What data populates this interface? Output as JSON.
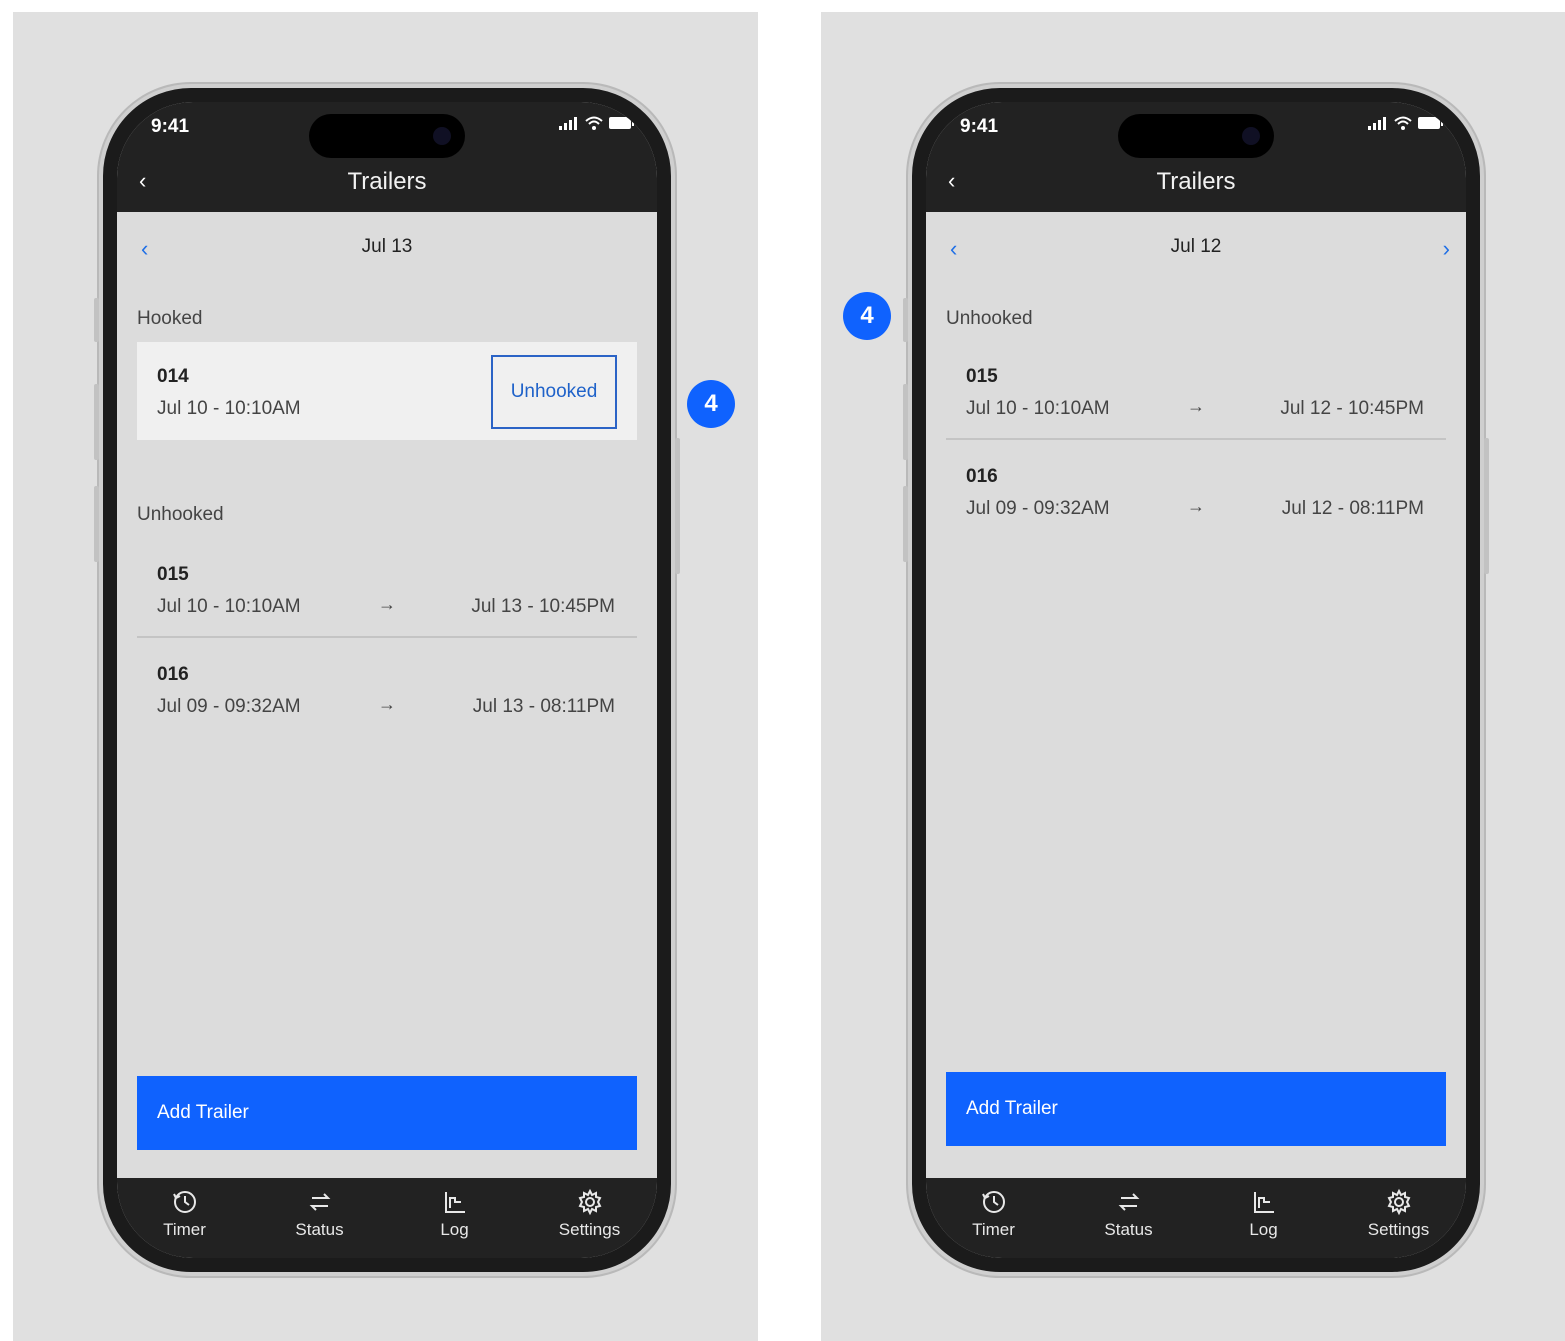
{
  "left": {
    "status_time": "9:41",
    "title": "Trailers",
    "date": "Jul 13",
    "hooked_heading": "Hooked",
    "hooked": [
      {
        "id": "014",
        "start": "Jul 10  - 10:10AM",
        "action": "Unhooked"
      }
    ],
    "unhooked_heading": "Unhooked",
    "unhooked": [
      {
        "id": "015",
        "start": "Jul 10  - 10:10AM",
        "arrow": "→",
        "end": "Jul 13  - 10:45PM"
      },
      {
        "id": "016",
        "start": "Jul 09  - 09:32AM",
        "arrow": "→",
        "end": "Jul 13  - 08:11PM"
      }
    ],
    "add_button": "Add Trailer",
    "tabs": [
      "Timer",
      "Status",
      "Log",
      "Settings"
    ],
    "badge": "4"
  },
  "right": {
    "status_time": "9:41",
    "title": "Trailers",
    "date": "Jul 12",
    "unhooked_heading": "Unhooked",
    "unhooked": [
      {
        "id": "015",
        "start": "Jul 10  - 10:10AM",
        "arrow": "→",
        "end": "Jul 12  - 10:45PM"
      },
      {
        "id": "016",
        "start": "Jul 09  - 09:32AM",
        "arrow": "→",
        "end": "Jul 12  - 08:11PM"
      }
    ],
    "add_button": "Add Trailer",
    "tabs": [
      "Timer",
      "Status",
      "Log",
      "Settings"
    ],
    "badge": "4"
  },
  "colors": {
    "accent": "#0f62fe",
    "link": "#1f6fe6",
    "bar": "#222222",
    "screen_bg": "#dcdcdc"
  },
  "icons": [
    "back-chevron-icon",
    "signal-icon",
    "wifi-icon",
    "battery-icon",
    "prev-date-icon",
    "next-date-icon",
    "timer-icon",
    "status-icon",
    "log-icon",
    "settings-icon"
  ]
}
